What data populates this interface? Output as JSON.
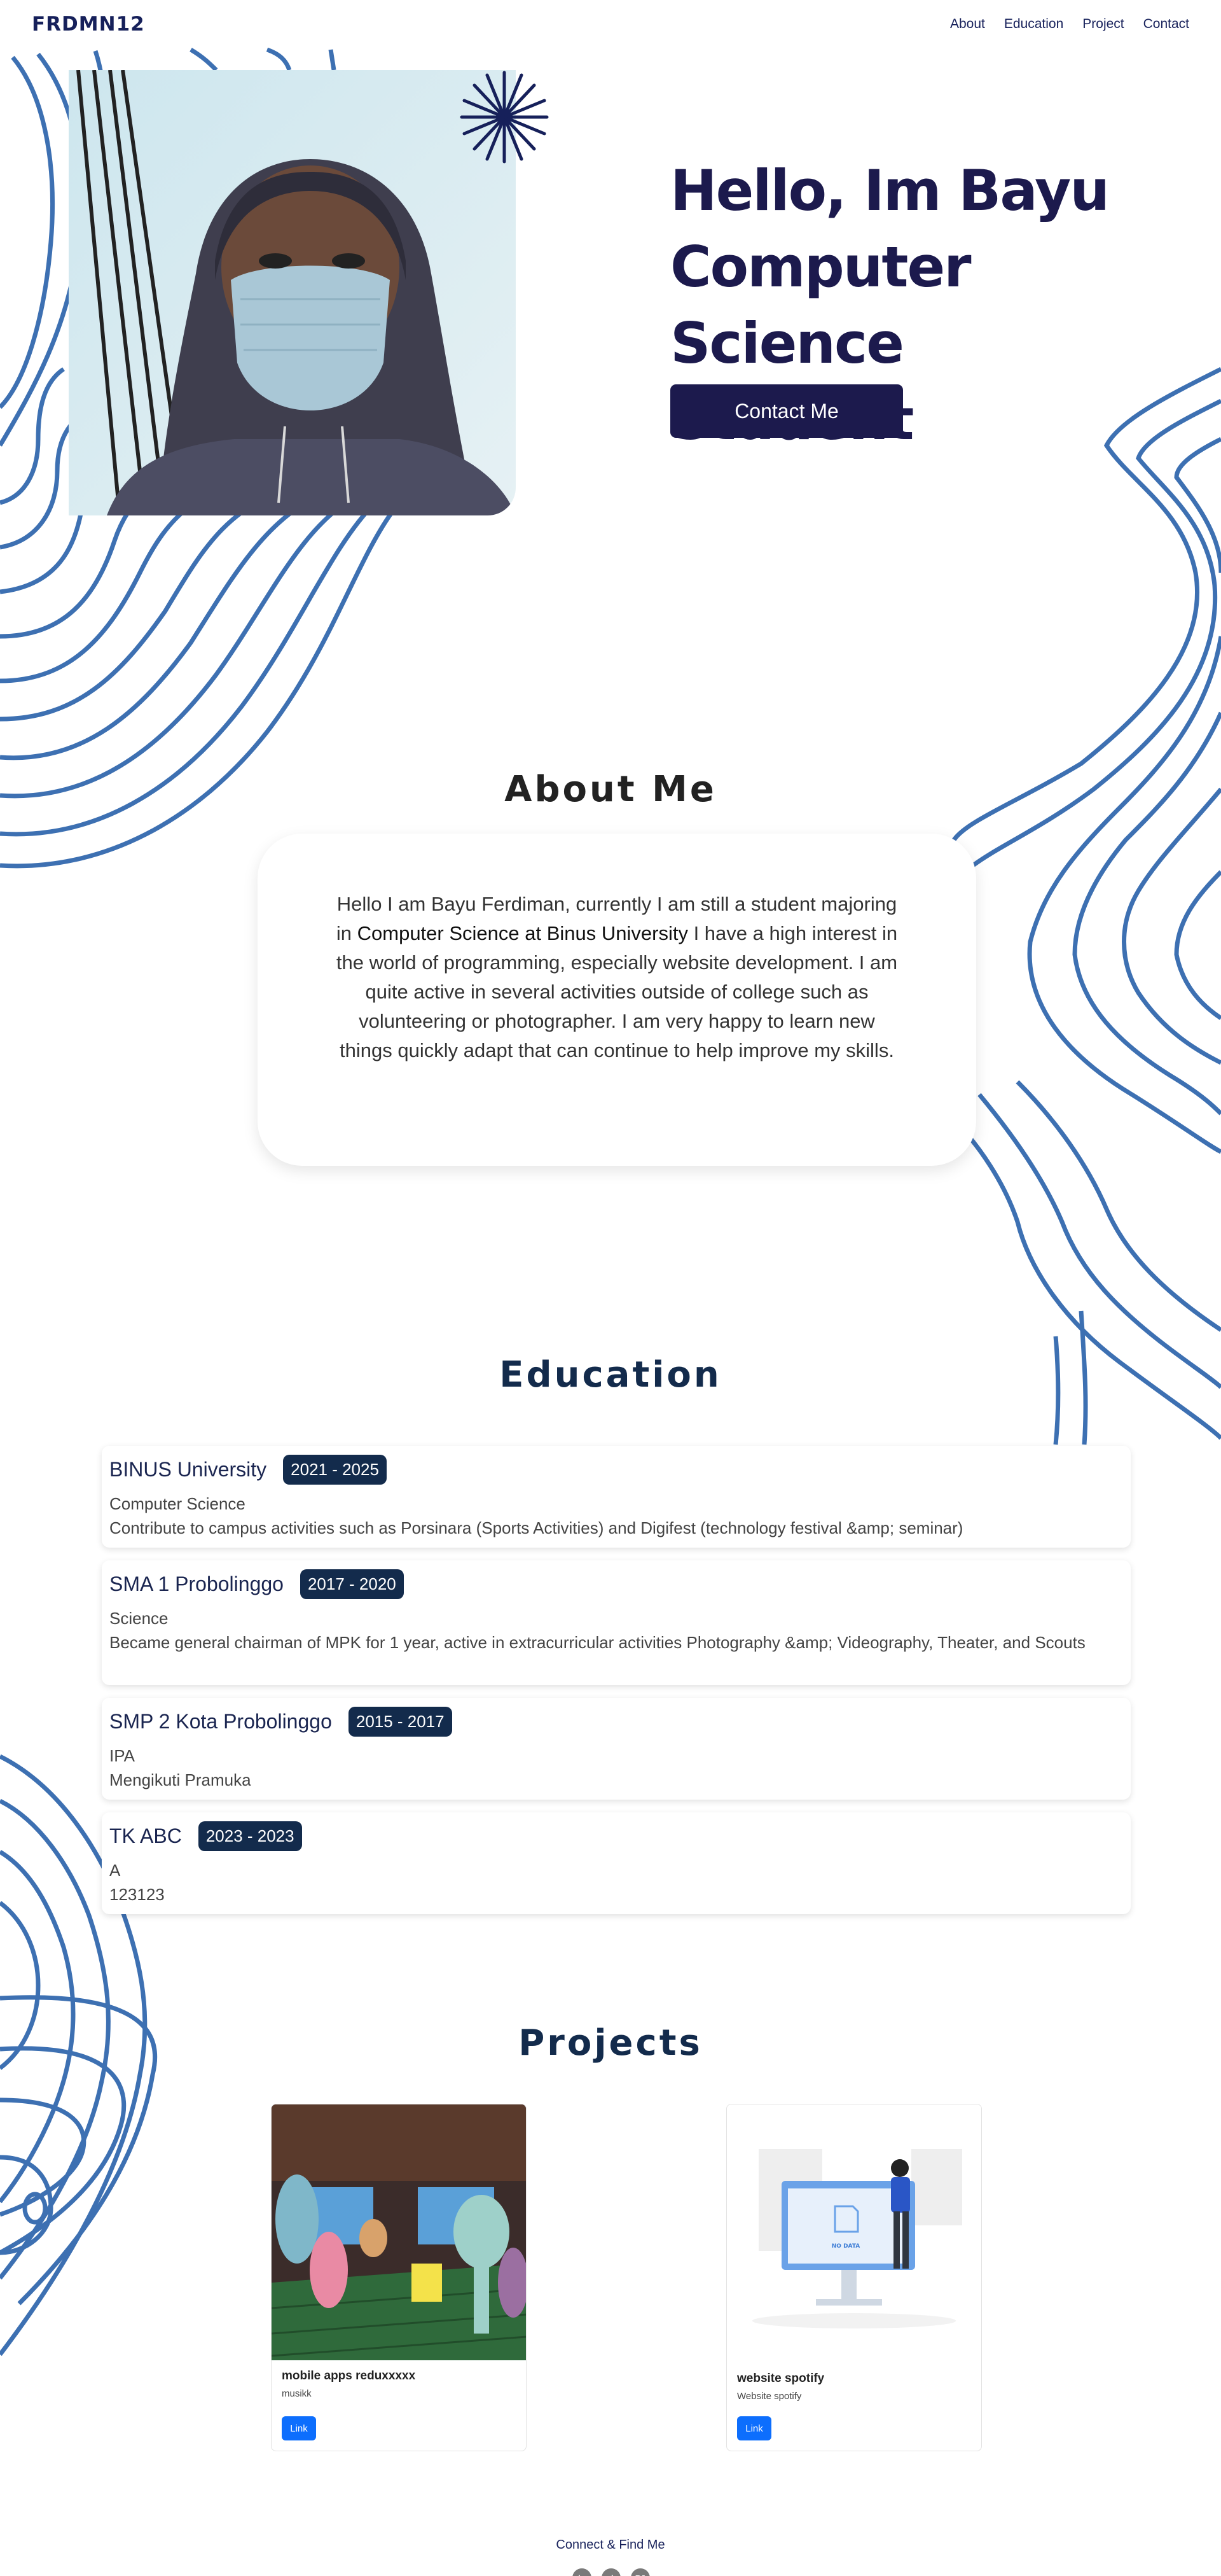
{
  "nav": {
    "brand": "FRDMN12",
    "links": [
      "About",
      "Education",
      "Project",
      "Contact"
    ]
  },
  "hero": {
    "title_line1": "Hello, Im Bayu",
    "title_line2": "Computer Science",
    "title_line3": "Student",
    "contact_label": "Contact Me"
  },
  "about": {
    "title": "About Me",
    "text_before": "Hello I am Bayu Ferdiman, currently I am still a student majoring in ",
    "text_bold": "Computer Science at Binus University",
    "text_after": " I have a high interest in the world of programming, especially website development. I am quite active in several activities outside of college such as volunteering or photographer. I am very happy to learn new things quickly adapt that can continue to help improve my skills."
  },
  "education": {
    "title": "Education",
    "items": [
      {
        "name": "BINUS University",
        "years": "2021 - 2025",
        "major": "Computer Science",
        "desc": "Contribute to campus activities such as Porsinara (Sports Activities) and Digifest (technology festival &amp; seminar)"
      },
      {
        "name": "SMA 1 Probolinggo",
        "years": "2017 - 2020",
        "major": "Science",
        "desc": "Became general chairman of MPK for 1 year, active in extracurricular activities Photography &amp; Videography, Theater, and Scouts"
      },
      {
        "name": "SMP 2 Kota Probolinggo",
        "years": "2015 - 2017",
        "major": "IPA",
        "desc": "Mengikuti Pramuka"
      },
      {
        "name": "TK ABC",
        "years": "2023 - 2023",
        "major": "A",
        "desc": "123123"
      }
    ]
  },
  "projects": {
    "title": "Projects",
    "items": [
      {
        "name": "mobile apps reduxxxxx",
        "desc": "musikk",
        "link": "Link"
      },
      {
        "name": "website spotify",
        "desc": "Website spotify",
        "link": "Link",
        "image_caption": "NO DATA"
      }
    ]
  },
  "footer": {
    "text": "Connect & Find Me",
    "socials": [
      {
        "icon": "linkedin-icon",
        "glyph": "in"
      },
      {
        "icon": "github-icon",
        "glyph": "gh"
      },
      {
        "icon": "behance-icon",
        "glyph": "Bē"
      }
    ]
  },
  "colors": {
    "navy": "#1c1a4d",
    "contour": "#3d70b2",
    "badge": "#132b4c",
    "link_button": "#0d6efd"
  }
}
